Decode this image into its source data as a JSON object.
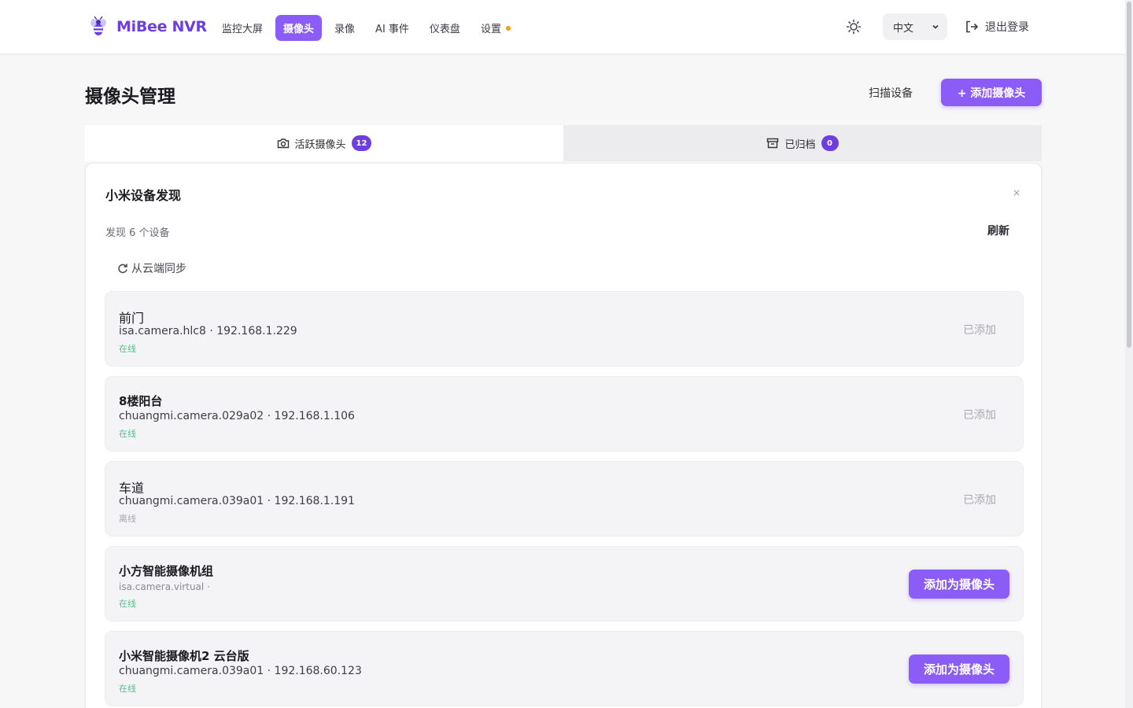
{
  "app": {
    "brand": "MiBee NVR",
    "colors": {
      "accent": "#8b5cf6",
      "brand": "#6d3fe0",
      "online": "#4cc38a",
      "nav_dot": "#f59e0b"
    }
  },
  "nav": {
    "items": [
      {
        "label": "监控大屏",
        "active": false
      },
      {
        "label": "摄像头",
        "active": true
      },
      {
        "label": "录像",
        "active": false
      },
      {
        "label": "AI 事件",
        "active": false
      },
      {
        "label": "仪表盘",
        "active": false
      },
      {
        "label": "设置",
        "active": false,
        "dot": true
      }
    ]
  },
  "header": {
    "theme_icon": "sun-icon",
    "language": "中文",
    "logout_label": "退出登录"
  },
  "page": {
    "title": "摄像头管理",
    "scan_label": "扫描设备",
    "add_camera_label": "+ 添加摄像头"
  },
  "tabs": [
    {
      "label": "活跃摄像头",
      "count": "12",
      "icon": "camera-icon",
      "active": true
    },
    {
      "label": "已归档",
      "count": "0",
      "icon": "archive-icon",
      "active": false
    }
  ],
  "discovery": {
    "title": "小米设备发现",
    "close_glyph": "×",
    "found_text": "发现 6 个设备",
    "refresh_label": "刷新",
    "cloud_sync_label": "从云端同步",
    "devices": [
      {
        "name": "前门",
        "model": "isa.camera.hlc8",
        "ip": "192.168.1.229",
        "meta": "isa.camera.hlc8 · 192.168.1.229",
        "status": "在线",
        "online": true,
        "action": "已添加",
        "added": true
      },
      {
        "name": "8楼阳台",
        "model": "chuangmi.camera.029a02",
        "ip": "192.168.1.106",
        "meta": "chuangmi.camera.029a02 · 192.168.1.106",
        "status": "在线",
        "online": true,
        "action": "已添加",
        "added": true
      },
      {
        "name": "车道",
        "model": "chuangmi.camera.039a01",
        "ip": "192.168.1.191",
        "meta": "chuangmi.camera.039a01 · 192.168.1.191",
        "status": "离线",
        "online": false,
        "action": "已添加",
        "added": true
      },
      {
        "name": "小方智能摄像机组",
        "model": "isa.camera.virtual",
        "ip": "",
        "meta": "isa.camera.virtual ·",
        "status": "在线",
        "online": true,
        "action": "添加为摄像头",
        "added": false
      },
      {
        "name": "小米智能摄像机2 云台版",
        "model": "chuangmi.camera.039a01",
        "ip": "192.168.60.123",
        "meta": "chuangmi.camera.039a01 · 192.168.60.123",
        "status": "在线",
        "online": true,
        "action": "添加为摄像头",
        "added": false
      }
    ]
  }
}
